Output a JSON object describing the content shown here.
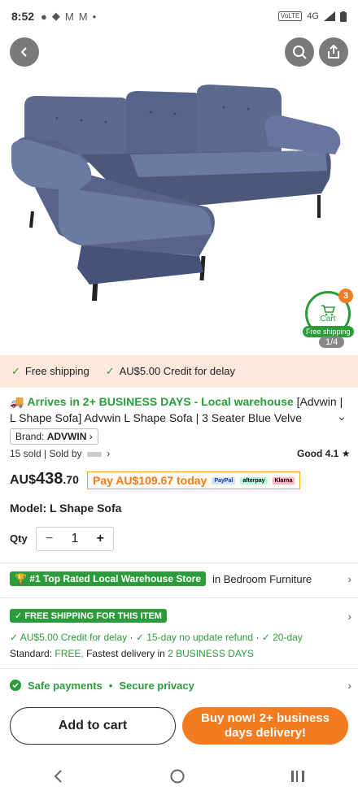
{
  "status_bar": {
    "time": "8:52",
    "network": "4G"
  },
  "hero": {
    "cart_count": "3",
    "cart_label": "Cart",
    "free_shipping_pill": "Free shipping",
    "image_counter": "1/4"
  },
  "benefits_strip": {
    "free_shipping": "Free shipping",
    "credit": "AU$5.00 Credit for delay"
  },
  "product": {
    "arrival_text": "Arrives in 2+ BUSINESS DAYS",
    "local_warehouse": "- Local warehouse",
    "title": "[Advwin | L Shape Sofa] Advwin L Shape Sofa | 3 Seater Blue Velve",
    "brand_label": "Brand:",
    "brand_name": "ADVWIN",
    "sold_count": "15 sold",
    "sold_by": "Sold by",
    "rating": "Good 4.1",
    "price_currency": "AU$",
    "price_main": "438",
    "price_cents": ".70",
    "pay_today": "Pay AU$109.67 today",
    "pay_logos": [
      "PayPal",
      "afterpay",
      "Klarna"
    ],
    "model_label": "Model: L Shape Sofa",
    "qty_label": "Qty",
    "qty_value": "1"
  },
  "store": {
    "badge": "#1 Top Rated Local Warehouse Store",
    "category": "in Bedroom Furniture"
  },
  "shipping": {
    "badge": "FREE SHIPPING FOR THIS ITEM",
    "benefit1": "AU$5.00 Credit for delay",
    "benefit2": "15-day no update refund",
    "benefit3": "20-day",
    "standard_label": "Standard:",
    "standard_free": "FREE,",
    "fastest": "Fastest delivery in",
    "fastest_days": "2 BUSINESS DAYS"
  },
  "safety": {
    "safe_payments": "Safe payments",
    "secure_privacy": "Secure privacy"
  },
  "actions": {
    "add_to_cart": "Add to cart",
    "buy_now": "Buy now! 2+ business days delivery!"
  },
  "colors": {
    "accent_orange": "#f47c20",
    "accent_green": "#2a9d3a",
    "strip_bg": "#fde8dc"
  }
}
